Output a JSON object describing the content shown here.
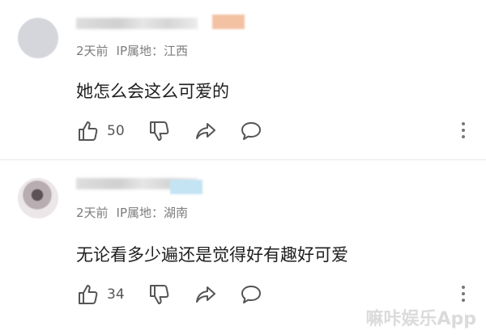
{
  "comments": [
    {
      "time": "2天前",
      "ip_label": "IP属地：江西",
      "text": "她怎么会这么可爱的",
      "likes": "50"
    },
    {
      "time": "2天前",
      "ip_label": "IP属地：湖南",
      "text": "无论看多少遍还是觉得好有趣好可爱",
      "likes": "34"
    }
  ],
  "icons": [
    "thumbs-up-icon",
    "thumbs-down-icon",
    "share-icon",
    "reply-bubble-icon",
    "more-vertical-icon"
  ],
  "watermark": "嘛咔娱乐App"
}
